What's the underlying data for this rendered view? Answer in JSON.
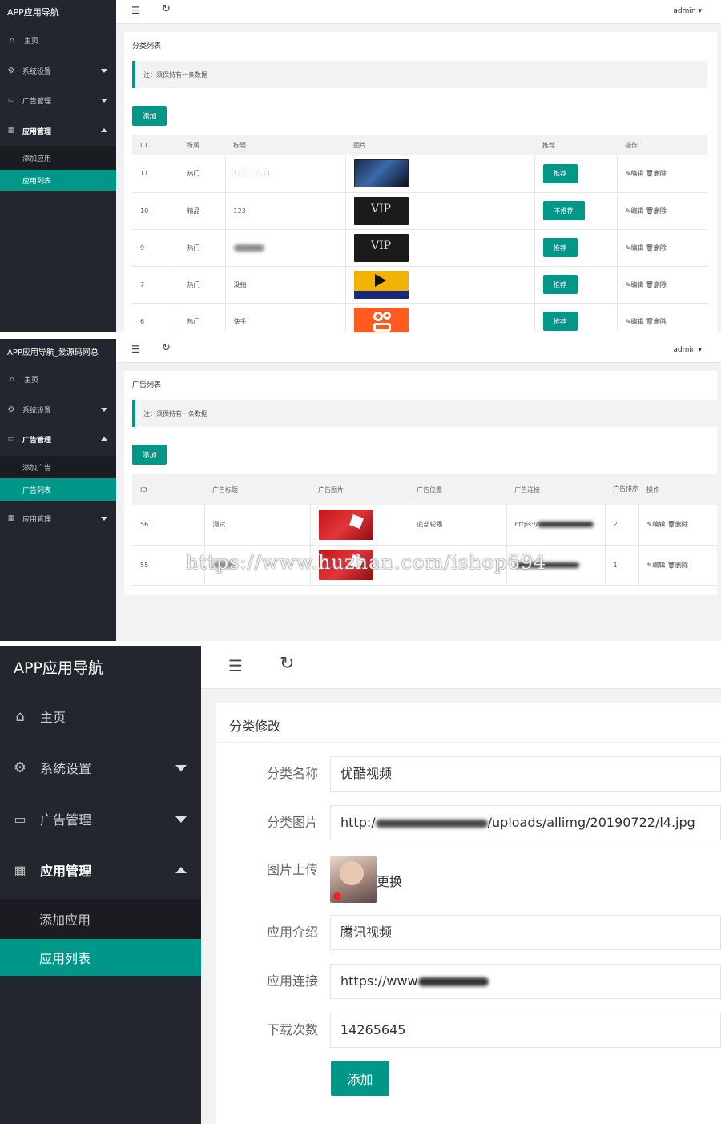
{
  "panel1": {
    "brand": "APP应用导航",
    "nav": [
      {
        "label": "主页",
        "icon": "home-icon"
      },
      {
        "label": "系统设置",
        "icon": "gear-icon"
      },
      {
        "label": "广告管理",
        "icon": "ad-icon"
      },
      {
        "label": "应用管理",
        "icon": "apps-icon"
      }
    ],
    "subnav": [
      "添加应用",
      "应用列表"
    ],
    "topbar": {
      "admin": "admin"
    },
    "card_title": "分类列表",
    "note": "注：须保持有一条数据",
    "add_button": "添加",
    "columns": [
      "ID",
      "所属",
      "标题",
      "图片",
      "推荐",
      "操作"
    ],
    "rows": [
      {
        "id": "11",
        "category": "热门",
        "title": "111111111",
        "rec": "推荐",
        "img": "thumb-game"
      },
      {
        "id": "10",
        "category": "精品",
        "title": "123",
        "rec": "不推荐",
        "img": "thumb-vip"
      },
      {
        "id": "9",
        "category": "热门",
        "title": "",
        "rec": "推荐",
        "img": "thumb-vip"
      },
      {
        "id": "7",
        "category": "热门",
        "title": "没拍",
        "rec": "推荐",
        "img": "thumb-vr"
      },
      {
        "id": "6",
        "category": "热门",
        "title": "快手",
        "rec": "推荐",
        "img": "thumb-kuaishou"
      }
    ],
    "edit": "编辑",
    "delete": "删除"
  },
  "panel2": {
    "brand": "APP应用导航_爱源码网总",
    "nav": [
      {
        "label": "主页",
        "icon": "home-icon"
      },
      {
        "label": "系统设置",
        "icon": "gear-icon"
      },
      {
        "label": "广告管理",
        "icon": "ad-icon"
      },
      {
        "label": "应用管理",
        "icon": "apps-icon"
      }
    ],
    "subnav": [
      "添加广告",
      "广告列表"
    ],
    "topbar": {
      "admin": "admin"
    },
    "card_title": "广告列表",
    "note": "注：须保持有一条数据",
    "add_button": "添加",
    "columns": [
      "ID",
      "广告标题",
      "广告图片",
      "广告位置",
      "广告连接",
      "广告排序",
      "操作"
    ],
    "rows": [
      {
        "id": "56",
        "title": "测试",
        "position": "底部轮播",
        "link": "https://",
        "sort": "2"
      },
      {
        "id": "55",
        "title": "",
        "position": "",
        "link": "",
        "sort": "1"
      }
    ],
    "edit": "编辑",
    "delete": "删除",
    "watermark": "https://www.huzhan.com/ishop694"
  },
  "panel3": {
    "brand": "APP应用导航",
    "nav": [
      {
        "label": "主页",
        "icon": "home-icon"
      },
      {
        "label": "系统设置",
        "icon": "gear-icon"
      },
      {
        "label": "广告管理",
        "icon": "ad-icon"
      },
      {
        "label": "应用管理",
        "icon": "apps-icon"
      }
    ],
    "subnav": [
      "添加应用",
      "应用列表"
    ],
    "card_title": "分类修改",
    "fields": [
      {
        "label": "分类名称",
        "value": "优酷视频"
      },
      {
        "label": "分类图片",
        "value_prefix": "http:/",
        "value_suffix": "/uploads/allimg/20190722/l4.jpg"
      },
      {
        "label": "图片上传",
        "action": "更换"
      },
      {
        "label": "应用介绍",
        "value": "腾讯视频"
      },
      {
        "label": "应用连接",
        "value_prefix": "https://www"
      },
      {
        "label": "下载次数",
        "value": "14265645"
      }
    ],
    "submit": "添加"
  },
  "colors": {
    "accent": "#009688",
    "sidebar": "#23262e",
    "subnav": "#1a1c21"
  }
}
